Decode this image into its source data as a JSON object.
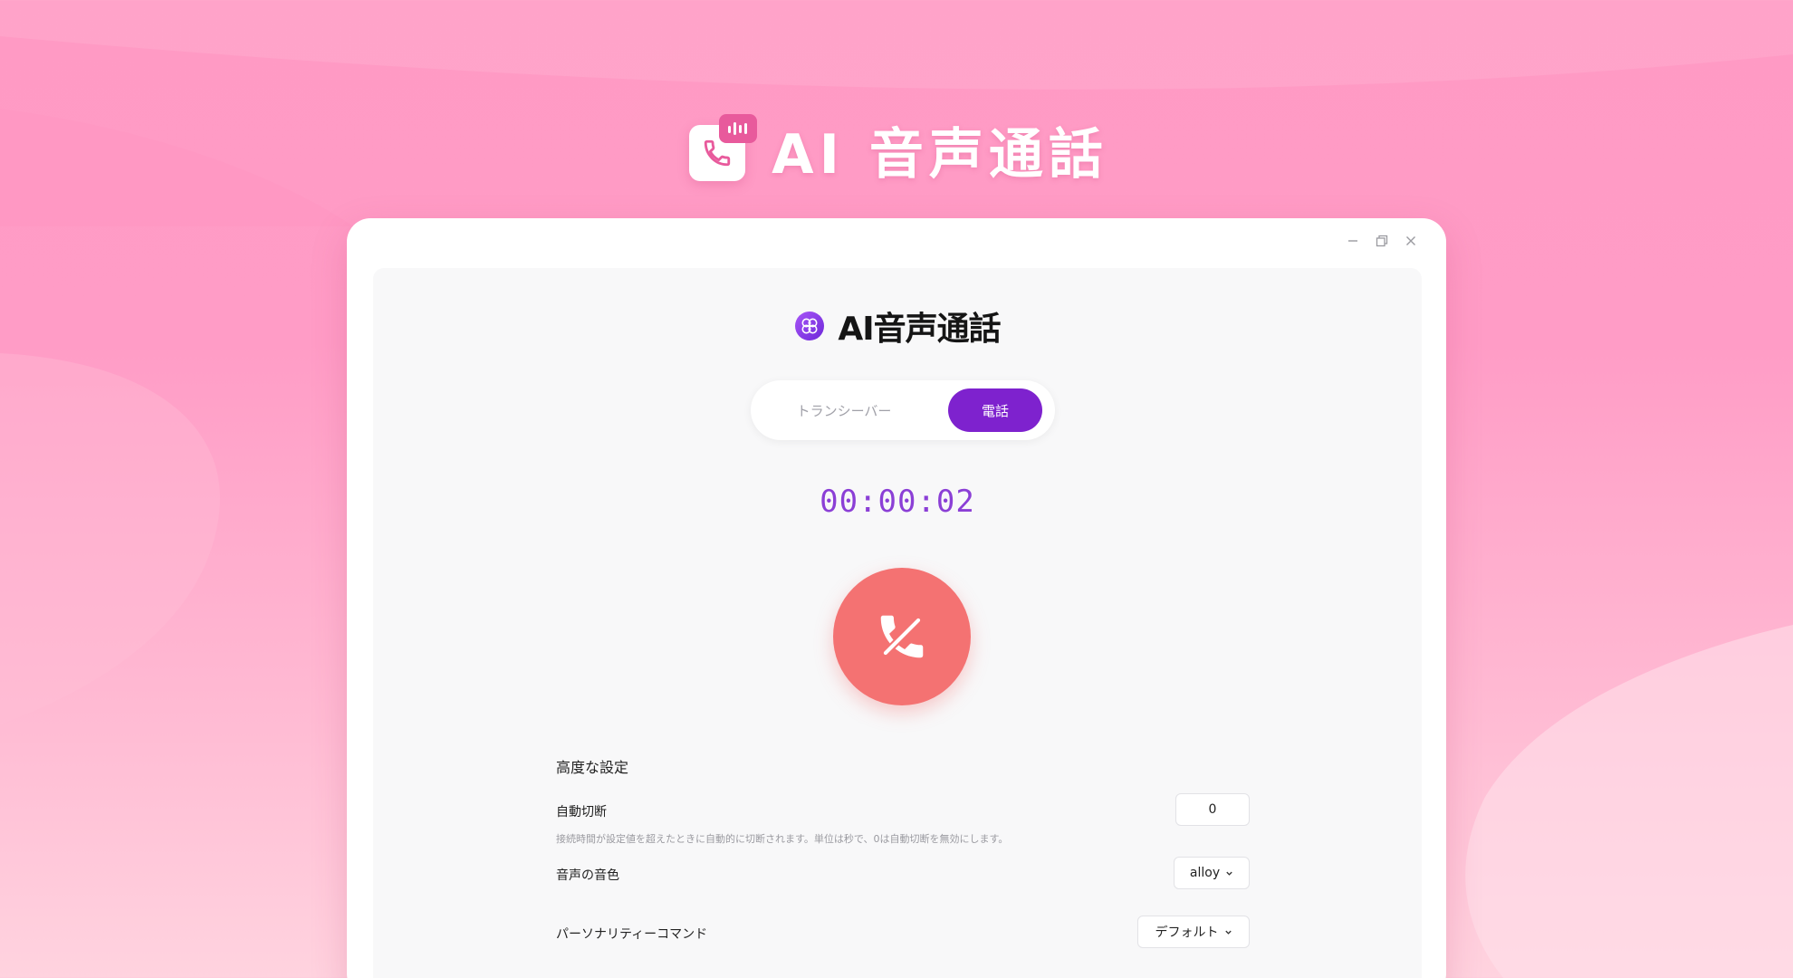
{
  "hero": {
    "title": "AI 音声通話"
  },
  "window": {
    "controls": {
      "minimize": "minimize-icon",
      "restore": "restore-icon",
      "close": "close-icon"
    }
  },
  "app": {
    "title": "AI音声通話",
    "mode_tabs": [
      {
        "label": "トランシーバー",
        "active": false
      },
      {
        "label": "電話",
        "active": true
      }
    ],
    "timer": "00:00:02",
    "hangup_icon": "phone-hangup-icon"
  },
  "settings": {
    "title": "高度な設定",
    "auto_disconnect": {
      "label": "自動切断",
      "value": "0",
      "description": "接続時間が設定値を超えたときに自動的に切断されます。単位は秒で、0は自動切断を無効にします。"
    },
    "voice": {
      "label": "音声の音色",
      "value": "alloy"
    },
    "personality": {
      "label": "パーソナリティーコマンド",
      "value": "デフォルト"
    }
  },
  "colors": {
    "accent": "#7e22ce",
    "timer": "#8b3fd6",
    "hangup": "#f47272",
    "background": "#ff9cc6"
  }
}
